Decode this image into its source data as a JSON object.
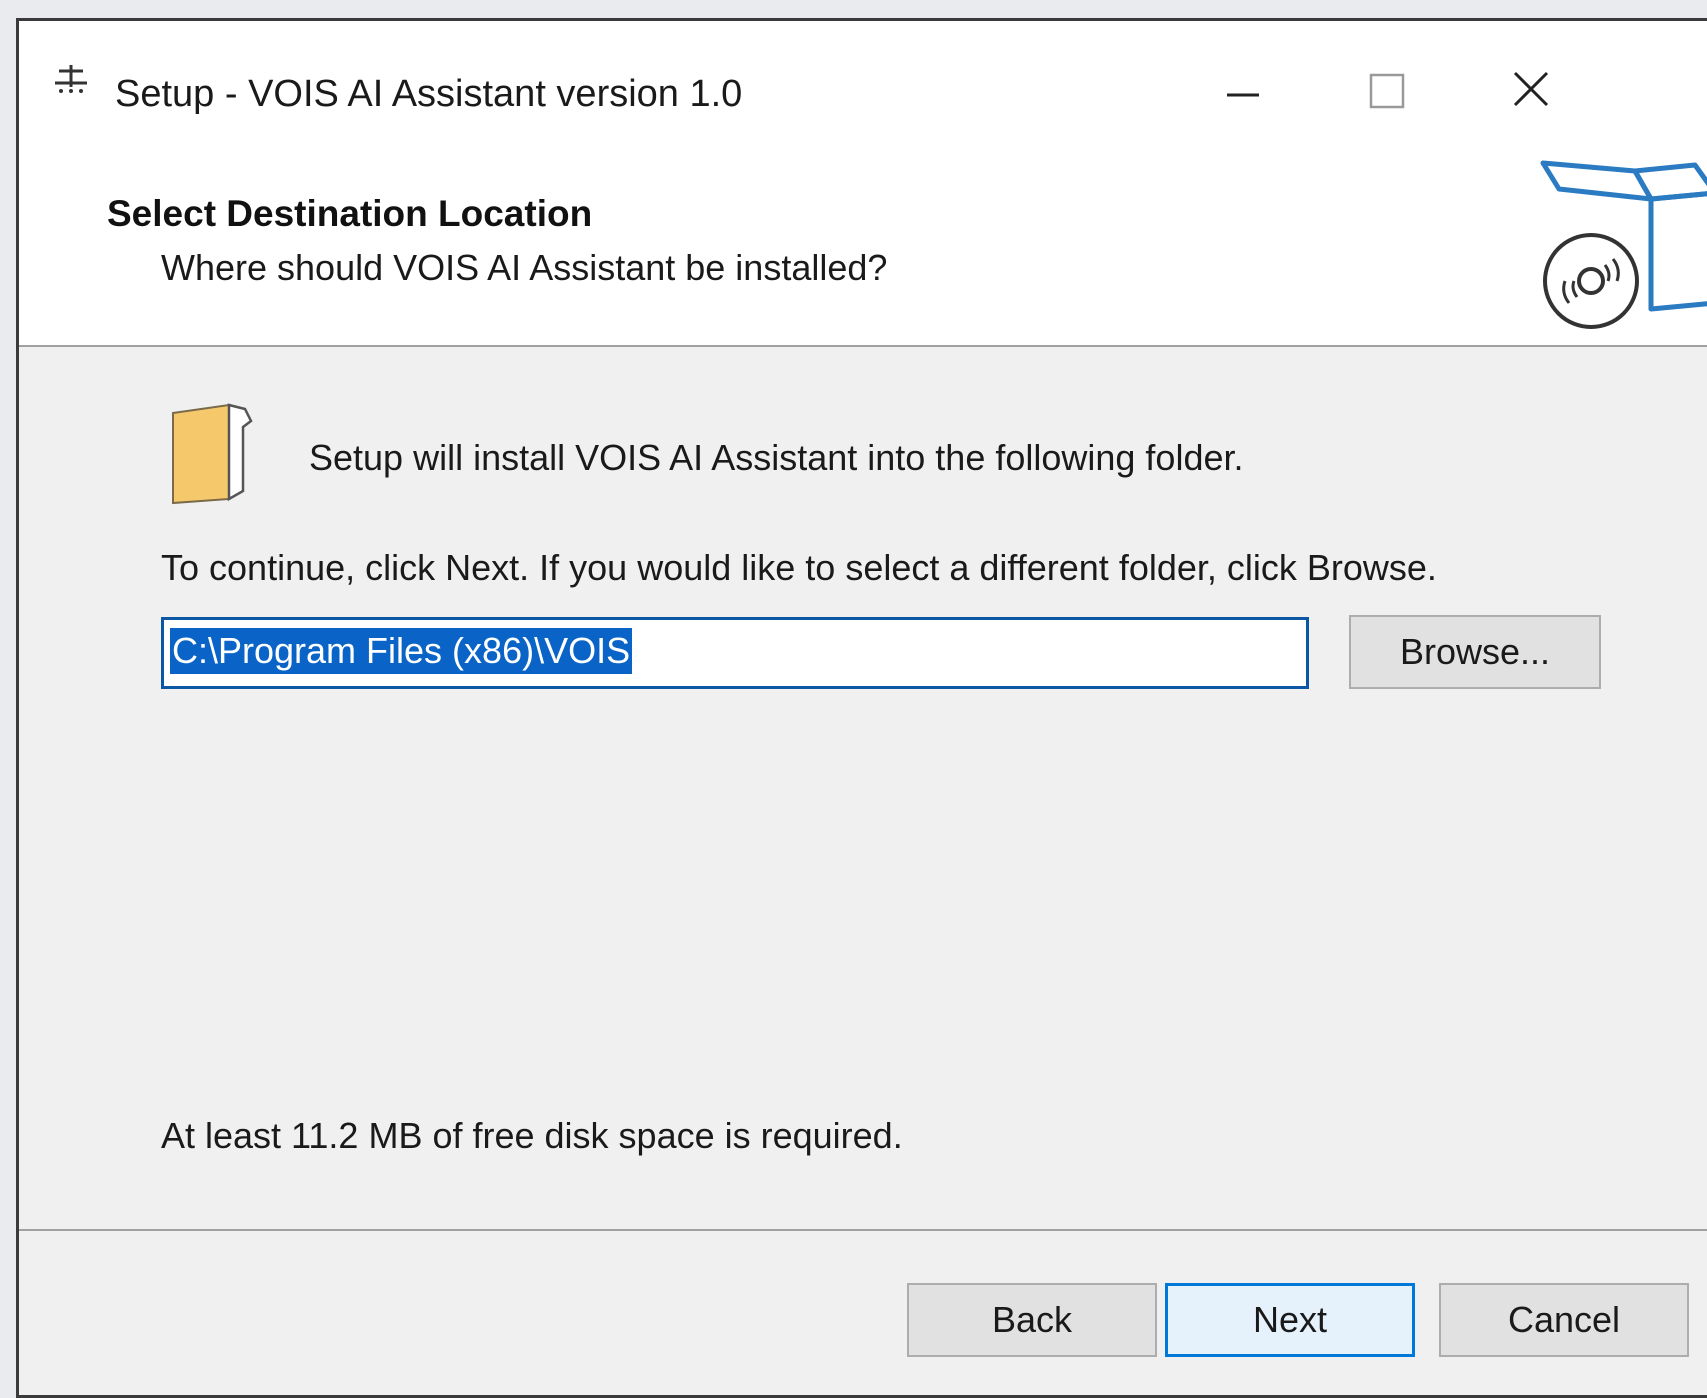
{
  "window": {
    "title": "Setup - VOIS AI Assistant version 1.0"
  },
  "header": {
    "title": "Select Destination Location",
    "subtitle": "Where should VOIS AI Assistant be installed?"
  },
  "content": {
    "info": "Setup will install VOIS AI Assistant into the following folder.",
    "instruction": "To continue, click Next. If you would like to select a different folder, click Browse.",
    "path_value": "C:\\Program Files (x86)\\VOIS",
    "browse_label": "Browse...",
    "disk_space": "At least 11.2 MB of free disk space is required."
  },
  "footer": {
    "back_label": "Back",
    "next_label": "Next",
    "cancel_label": "Cancel"
  },
  "colors": {
    "selection": "#0a64c8",
    "focus_border": "#0078d7",
    "folder": "#f5c96b",
    "box_icon": "#2a7bc2"
  },
  "icons": [
    "setup-app-icon",
    "minimize-icon",
    "maximize-icon",
    "close-icon",
    "box-disc-icon",
    "folder-icon"
  ]
}
